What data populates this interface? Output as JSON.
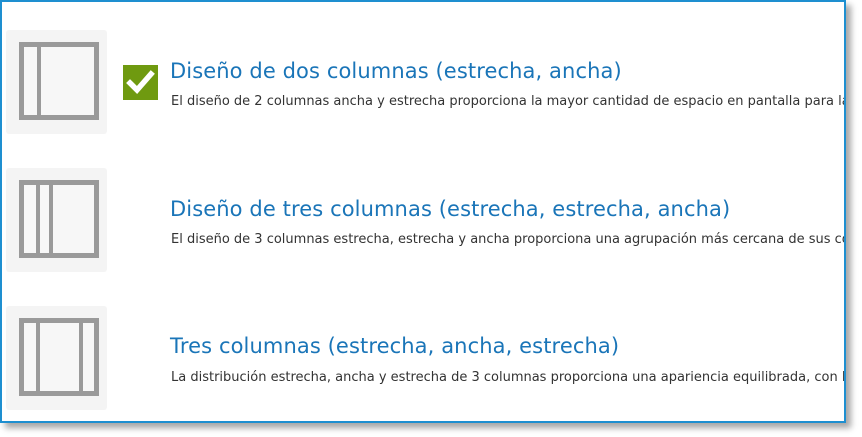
{
  "colors": {
    "accent": "#1a75b8",
    "border": "#1e8fd0",
    "check": "#6f9a10",
    "icon_stroke": "#9a9a9a"
  },
  "layouts": [
    {
      "title": "Diseño de dos columnas (estrecha, ancha)",
      "description": "El diseño de 2 columnas ancha y estrecha proporciona la mayor cantidad de espacio en pantalla para la",
      "icon": "two-column-layout-icon",
      "selected": true
    },
    {
      "title": "Diseño de tres columnas (estrecha, estrecha, ancha)",
      "description": "El diseño de 3 columnas estrecha, estrecha y ancha proporciona una agrupación más cercana de sus co",
      "icon": "three-column-narrow-narrow-wide-icon",
      "selected": false
    },
    {
      "title": "Tres columnas (estrecha, ancha, estrecha)",
      "description": "La distribución estrecha, ancha y estrecha de 3 columnas proporciona una apariencia equilibrada, con l",
      "icon": "three-column-narrow-wide-narrow-icon",
      "selected": false
    }
  ]
}
